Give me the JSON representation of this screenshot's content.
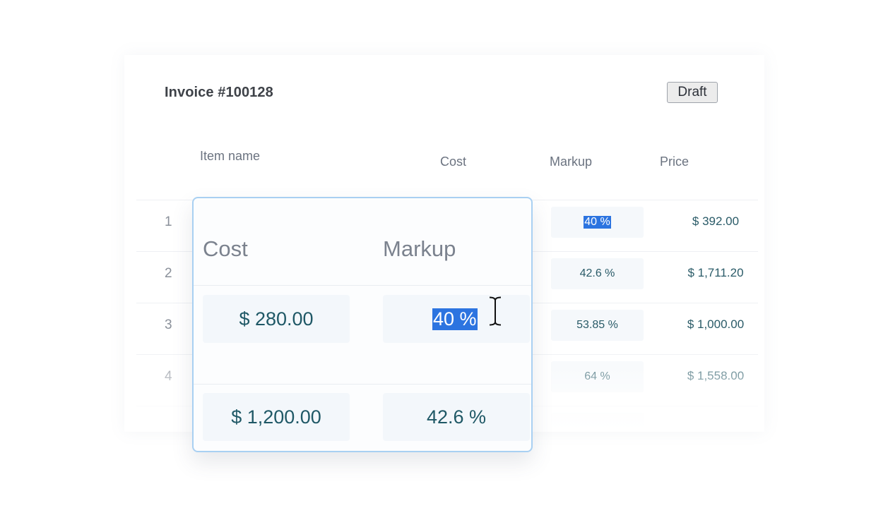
{
  "invoice": {
    "title": "Invoice #100128",
    "status_button": "Draft"
  },
  "columns": {
    "item": "Item name",
    "cost": "Cost",
    "markup": "Markup",
    "price": "Price"
  },
  "rows": [
    {
      "num": "1",
      "markup": "40 %",
      "price": "$ 392.00"
    },
    {
      "num": "2",
      "markup": "42.6 %",
      "price": "$ 1,711.20"
    },
    {
      "num": "3",
      "markup": "53.85 %",
      "price": "$ 1,000.00"
    },
    {
      "num": "4",
      "markup": "64 %",
      "price": "$ 1,558.00"
    }
  ],
  "zoom": {
    "cost_header": "Cost",
    "markup_header": "Markup",
    "rows": [
      {
        "cost": "$ 280.00",
        "markup": "40 %"
      },
      {
        "cost": "$ 1,200.00",
        "markup": "42.6 %"
      }
    ]
  },
  "colors": {
    "selection": "#2c74e0",
    "value_text": "#2a5b68",
    "zoom_border": "#a9d0f2"
  },
  "icons": {
    "cursor": "text-cursor-icon"
  }
}
